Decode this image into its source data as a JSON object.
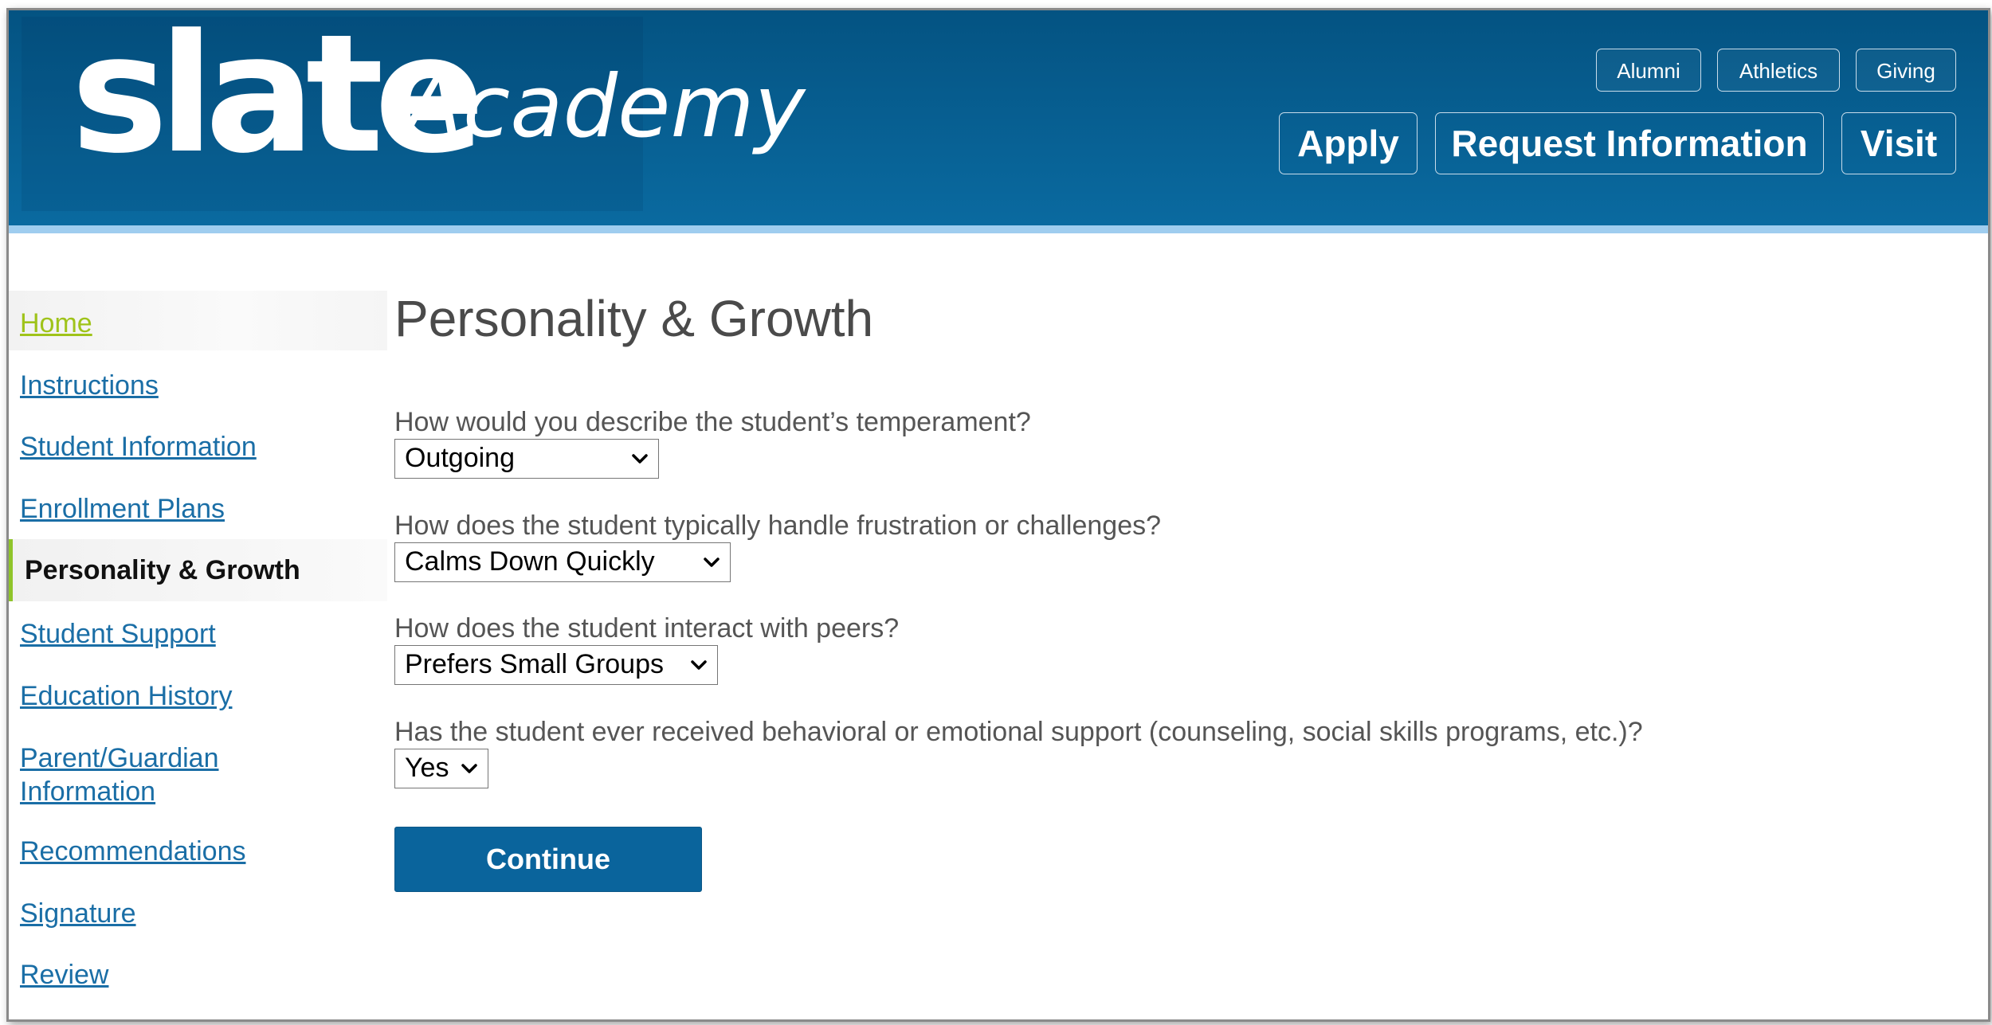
{
  "header": {
    "logo_main": "slate",
    "logo_sub": "Academy",
    "utility_links": [
      "Alumni",
      "Athletics",
      "Giving"
    ],
    "cta_buttons": [
      "Apply",
      "Request Information",
      "Visit"
    ],
    "colors": {
      "header_bg": "#045382",
      "stripe": "#9fcdef"
    }
  },
  "sidebar": {
    "items": [
      {
        "label": "Home",
        "state": "home"
      },
      {
        "label": "Instructions"
      },
      {
        "label": "Student Information"
      },
      {
        "label": "Enrollment Plans"
      },
      {
        "label": "Personality & Growth",
        "state": "active"
      },
      {
        "label": "Student Support"
      },
      {
        "label": "Education History"
      },
      {
        "label": "Parent/Guardian Information",
        "lines": [
          "Parent/Guardian",
          "Information"
        ]
      },
      {
        "label": "Recommendations"
      },
      {
        "label": "Signature"
      },
      {
        "label": "Review"
      }
    ],
    "colors": {
      "link": "#1a6ea6",
      "home_link": "#9fc31a",
      "active_marker": "#8fc42a"
    }
  },
  "main": {
    "title": "Personality & Growth",
    "questions": [
      {
        "label": "How would you describe the student’s temperament?",
        "value": "Outgoing"
      },
      {
        "label": "How does the student typically handle frustration or challenges?",
        "value": "Calms Down Quickly"
      },
      {
        "label": "How does the student interact with peers?",
        "value": "Prefers Small Groups"
      },
      {
        "label": "Has the student ever received behavioral or emotional support (counseling, social skills programs, etc.)?",
        "value": "Yes"
      }
    ],
    "continue_label": "Continue",
    "colors": {
      "button_bg": "#0a649c"
    }
  }
}
